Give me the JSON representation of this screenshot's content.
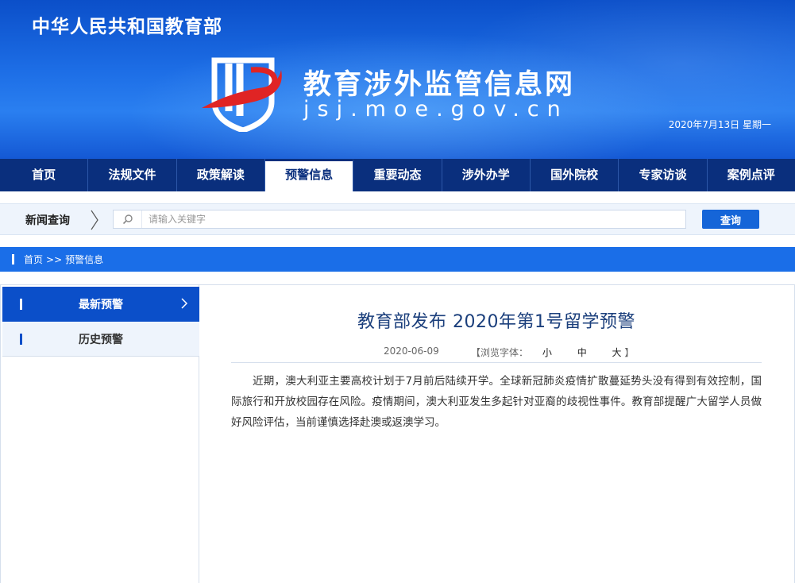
{
  "header": {
    "ministry": "中华人民共和国教育部",
    "site_title": "教育涉外监管信息网",
    "site_domain": "jsj.moe.gov.cn",
    "date": "2020年7月13日 星期一"
  },
  "nav": {
    "items": [
      {
        "label": "首页"
      },
      {
        "label": "法规文件"
      },
      {
        "label": "政策解读"
      },
      {
        "label": "预警信息"
      },
      {
        "label": "重要动态"
      },
      {
        "label": "涉外办学"
      },
      {
        "label": "国外院校"
      },
      {
        "label": "专家访谈"
      },
      {
        "label": "案例点评"
      }
    ],
    "active": "预警信息"
  },
  "search": {
    "label": "新闻查询",
    "placeholder": "请输入关键字",
    "button": "查询"
  },
  "breadcrumb": {
    "home": "首页",
    "separator": ">>",
    "current": "预警信息"
  },
  "sidebar": {
    "items": [
      {
        "label": "最新预警"
      },
      {
        "label": "历史预警"
      }
    ]
  },
  "article": {
    "title": "教育部发布 2020年第1号留学预警",
    "date": "2020-06-09",
    "font_label": "【浏览字体：",
    "font_small": "小",
    "font_medium": "中",
    "font_large": "大",
    "font_close": "】",
    "body": "近期，澳大利亚主要高校计划于7月前后陆续开学。全球新冠肺炎疫情扩散蔓延势头没有得到有效控制，国际旅行和开放校园存在风险。疫情期间，澳大利亚发生多起针对亚裔的歧视性事件。教育部提醒广大留学人员做好风险评估，当前谨慎选择赴澳或返澳学习。"
  },
  "colors": {
    "banner": "#1d6ee6",
    "navbar": "#0a2f7d",
    "accent": "#1a6ee8",
    "title": "#1b3f7c"
  }
}
